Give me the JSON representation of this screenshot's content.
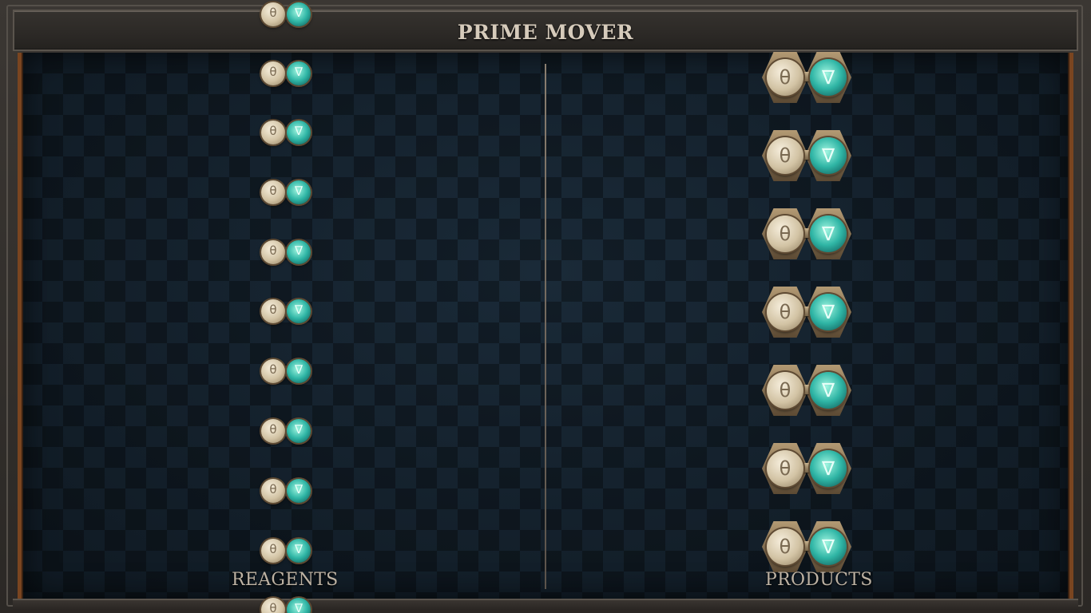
{
  "window": {
    "title": "PRIME MOVER"
  },
  "reagents": {
    "label": "REAGENTS",
    "items": [
      {
        "symbol_left": "θ",
        "symbol_right": "∇",
        "icon": "reagent-connector-icon"
      },
      {
        "symbol_left": "θ",
        "symbol_right": "∇",
        "icon": "reagent-connector-icon"
      },
      {
        "symbol_left": "θ",
        "symbol_right": "∇",
        "icon": "reagent-connector-icon"
      },
      {
        "symbol_left": "θ",
        "symbol_right": "∇",
        "icon": "reagent-connector-icon"
      },
      {
        "symbol_left": "θ",
        "symbol_right": "∇",
        "icon": "reagent-connector-icon"
      },
      {
        "symbol_left": "θ",
        "symbol_right": "∇",
        "icon": "reagent-connector-icon"
      },
      {
        "symbol_left": "θ",
        "symbol_right": "∇",
        "icon": "reagent-connector-icon"
      },
      {
        "symbol_left": "θ",
        "symbol_right": "∇",
        "icon": "reagent-connector-icon"
      },
      {
        "symbol_left": "θ",
        "symbol_right": "∇",
        "icon": "reagent-connector-icon"
      },
      {
        "symbol_left": "θ",
        "symbol_right": "∇",
        "icon": "reagent-connector-icon"
      },
      {
        "symbol_left": "θ",
        "symbol_right": "∇",
        "icon": "reagent-connector-icon"
      }
    ]
  },
  "products": {
    "label": "PRODUCTS",
    "items": [
      {
        "symbol_left": "θ",
        "symbol_right": "∇",
        "icon": "product-connector-icon"
      },
      {
        "symbol_left": "θ",
        "symbol_right": "∇",
        "icon": "product-connector-icon"
      },
      {
        "symbol_left": "θ",
        "symbol_right": "∇",
        "icon": "product-connector-icon"
      },
      {
        "symbol_left": "θ",
        "symbol_right": "∇",
        "icon": "product-connector-icon"
      },
      {
        "symbol_left": "θ",
        "symbol_right": "∇",
        "icon": "product-connector-icon"
      },
      {
        "symbol_left": "θ",
        "symbol_right": "∇",
        "icon": "product-connector-icon"
      },
      {
        "symbol_left": "θ",
        "symbol_right": "∇",
        "icon": "product-connector-icon"
      }
    ]
  },
  "colors": {
    "panel_bg": "#101a24",
    "frame": "#2b2825",
    "accent_wood": "#7a4520",
    "orb_light": "#d2c3a4",
    "orb_teal": "#2fb5a5",
    "text": "#d6cbbb"
  }
}
